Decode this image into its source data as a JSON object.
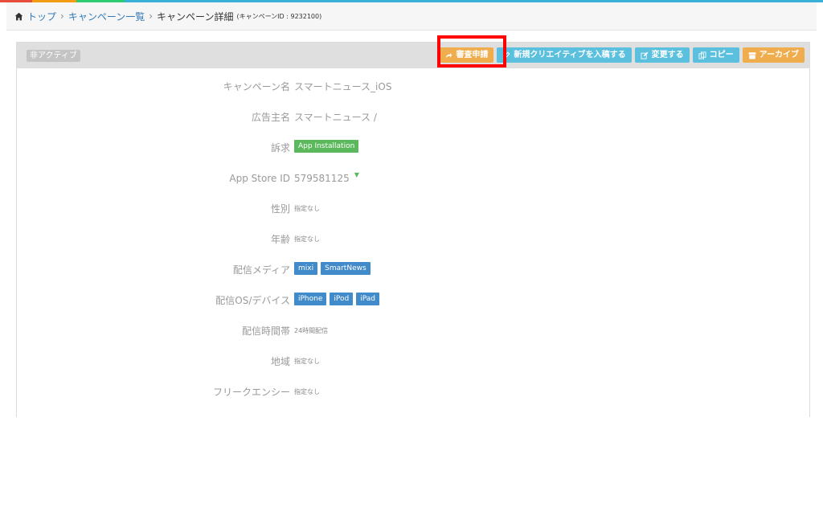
{
  "colors": {
    "topline": [
      "#e84c3d",
      "#f39c12",
      "#2ecc71",
      "#3ab0d8"
    ],
    "link": "#337ab7",
    "orange": "#f0ad4e",
    "cyan": "#5bc0de",
    "green": "#5cb85c",
    "blue": "#428bca",
    "highlight": "#ff0000"
  },
  "breadcrumb": {
    "home_icon": "home-icon",
    "top": "トップ",
    "list": "キャンペーン一覧",
    "current": "キャンペーン詳細",
    "campaign_id": "(キャンペーンID : 9232100)"
  },
  "panel": {
    "status": "非アクティブ",
    "actions": {
      "review": "審査申請",
      "new_creative": "新規クリエイティブを入稿する",
      "edit": "変更する",
      "copy": "コピー",
      "archive": "アーカイブ"
    }
  },
  "fields": {
    "campaign_name": {
      "label": "キャンペーン名",
      "value": "スマートニュース_iOS"
    },
    "advertiser": {
      "label": "広告主名",
      "value": "スマートニュース /"
    },
    "appeal": {
      "label": "訴求",
      "value": "App Installation"
    },
    "app_store_id": {
      "label": "App Store ID",
      "value": "579581125"
    },
    "gender": {
      "label": "性別",
      "value": "指定なし"
    },
    "age": {
      "label": "年齢",
      "value": "指定なし"
    },
    "media": {
      "label": "配信メディア",
      "tags": [
        "mixi",
        "SmartNews"
      ]
    },
    "os_device": {
      "label": "配信OS/デバイス",
      "tags": [
        "iPhone",
        "iPod",
        "iPad"
      ]
    },
    "time": {
      "label": "配信時間帯",
      "value": "24時間配信"
    },
    "region": {
      "label": "地域",
      "value": "指定なし"
    },
    "frequency": {
      "label": "フリークエンシー",
      "value": "指定なし"
    }
  }
}
